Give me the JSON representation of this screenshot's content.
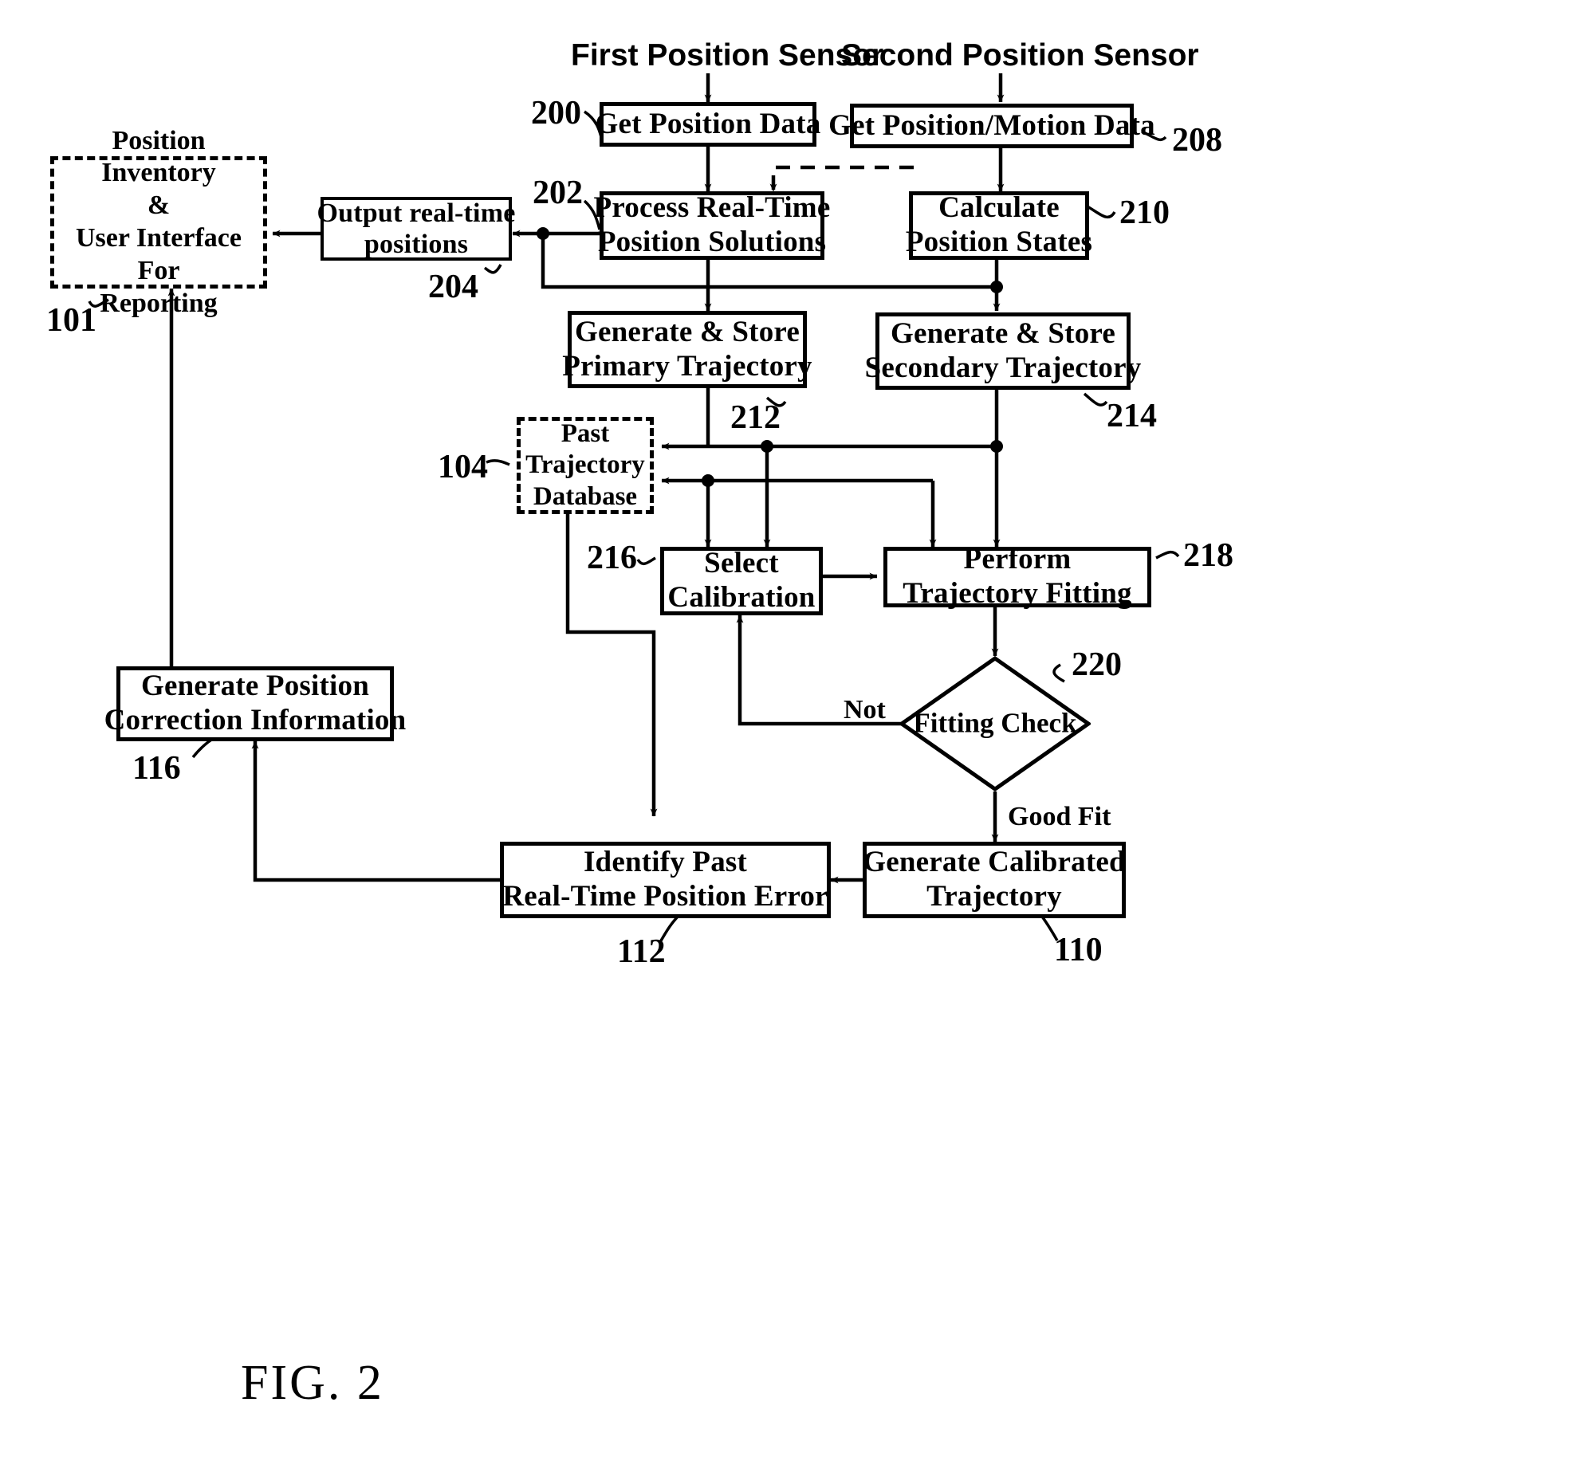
{
  "figure": {
    "caption": "FIG. 2",
    "headers": [
      {
        "id": "first-position-sensor",
        "text": "First Position Sensor"
      },
      {
        "id": "second-position-sensor",
        "text": "Second Position Sensor"
      }
    ]
  },
  "nodes": {
    "get_position_data": {
      "lines": [
        "Get Position Data"
      ],
      "ref": "200"
    },
    "get_position_motion_data": {
      "lines": [
        "Get Position/Motion Data"
      ],
      "ref": "208"
    },
    "process_real_time": {
      "lines": [
        "Process Real-Time",
        "Position Solutions"
      ],
      "ref": "202"
    },
    "calculate_position_states": {
      "lines": [
        "Calculate",
        "Position States"
      ],
      "ref": "210"
    },
    "output_real_time_positions": {
      "lines": [
        "Output real-time",
        "positions"
      ],
      "ref": "204"
    },
    "position_inventory": {
      "lines": [
        "Position Inventory",
        "&",
        "User Interface For",
        "Reporting"
      ],
      "ref": "101"
    },
    "generate_store_primary": {
      "lines": [
        "Generate & Store",
        "Primary Trajectory"
      ],
      "ref": "212"
    },
    "generate_store_secondary": {
      "lines": [
        "Generate & Store",
        "Secondary Trajectory"
      ],
      "ref": "214"
    },
    "past_trajectory_database": {
      "lines": [
        "Past",
        "Trajectory",
        "Database"
      ],
      "ref": "104"
    },
    "select_calibration": {
      "lines": [
        "Select",
        "Calibration"
      ],
      "ref": "216"
    },
    "perform_trajectory_fitting": {
      "lines": [
        "Perform",
        "Trajectory Fitting"
      ],
      "ref": "218"
    },
    "fitting_check": {
      "lines": [
        "Fitting",
        "Check"
      ],
      "ref": "220"
    },
    "generate_calibrated_trajectory": {
      "lines": [
        "Generate Calibrated",
        "Trajectory"
      ],
      "ref": "110"
    },
    "identify_past_error": {
      "lines": [
        "Identify Past",
        "Real-Time Position Error"
      ],
      "ref": "112"
    },
    "generate_position_correction": {
      "lines": [
        "Generate Position",
        "Correction Information"
      ],
      "ref": "116"
    }
  },
  "edge_labels": {
    "not": "Not",
    "good_fit": "Good Fit"
  },
  "colors": {
    "ink": "#000000",
    "paper": "#ffffff"
  }
}
